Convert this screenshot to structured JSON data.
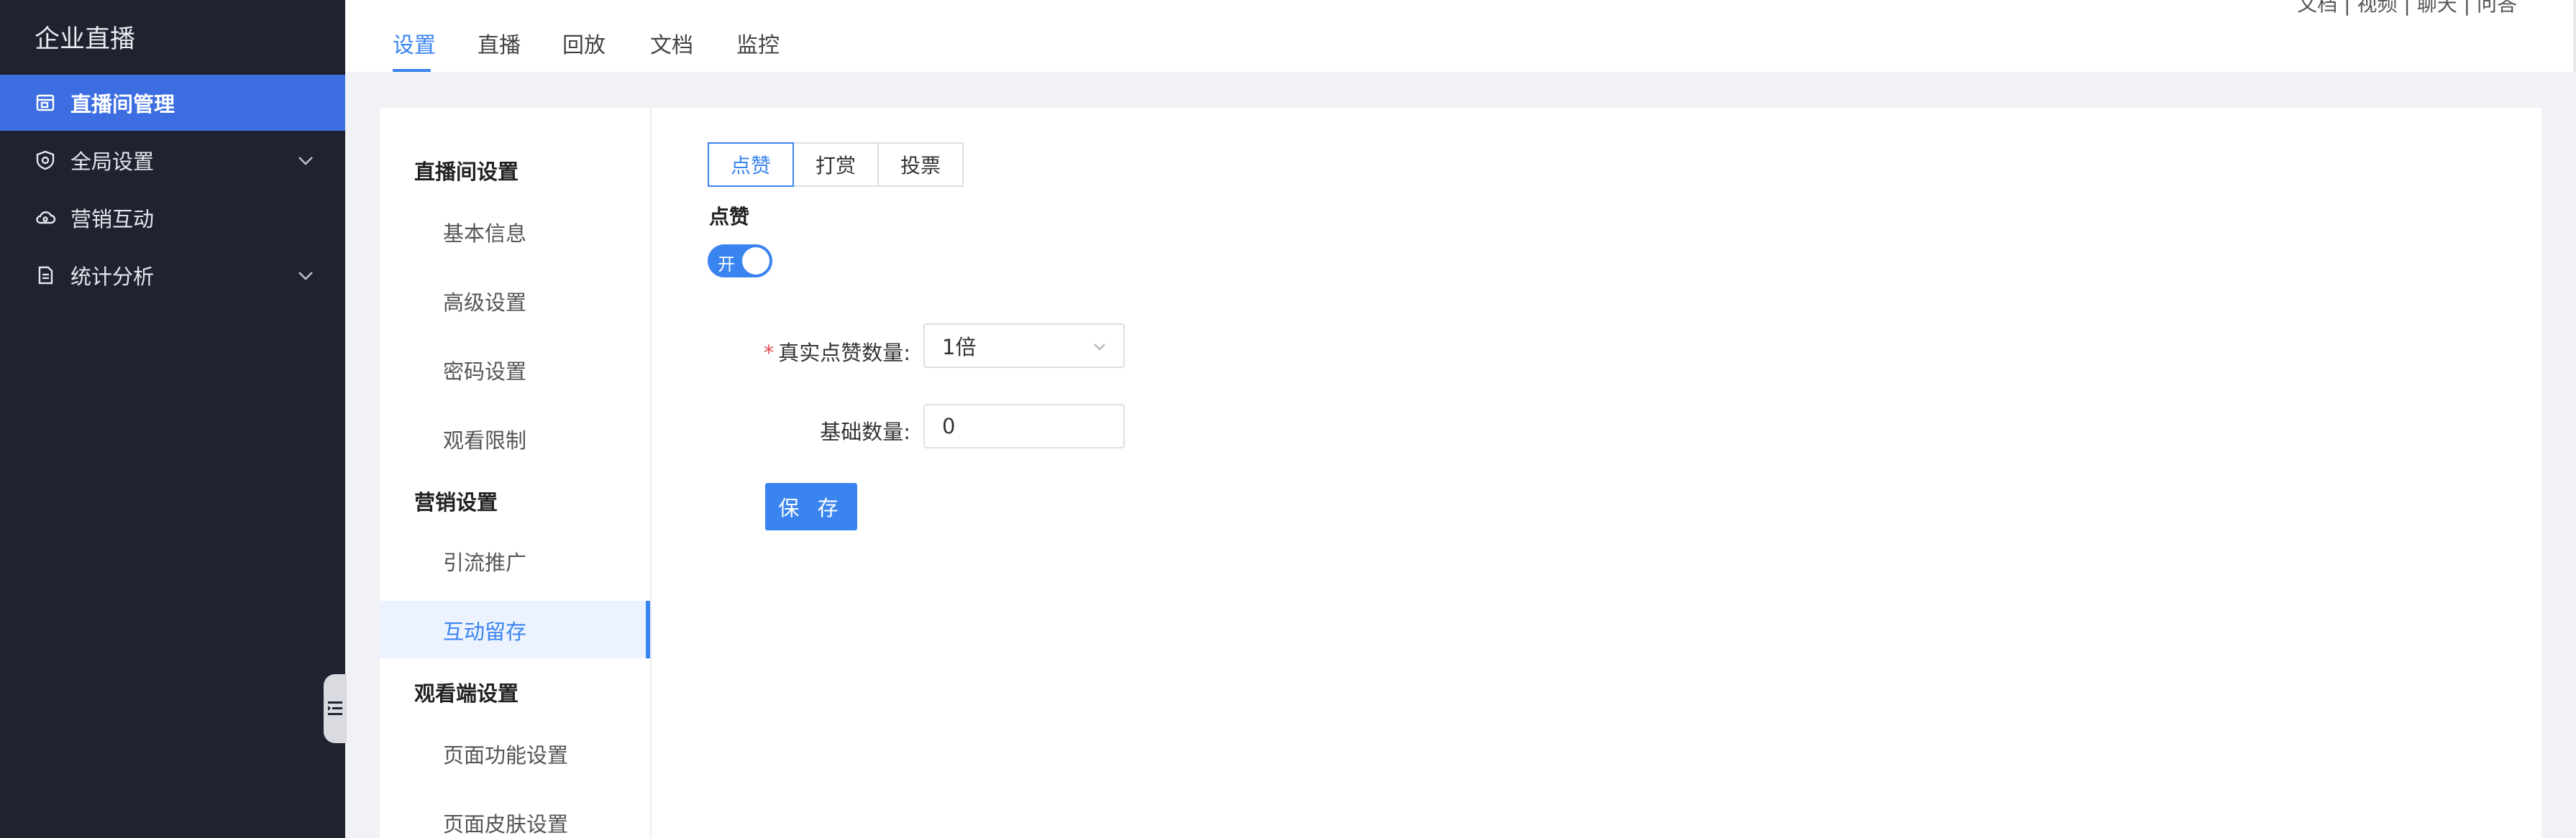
{
  "app": {
    "brand": "企业直播"
  },
  "sidebar": {
    "items": [
      {
        "label": "直播间管理",
        "icon": "live-room-icon",
        "active": true
      },
      {
        "label": "全局设置",
        "icon": "shield-icon",
        "expandable": true
      },
      {
        "label": "营销互动",
        "icon": "cloud-icon"
      },
      {
        "label": "统计分析",
        "icon": "report-icon",
        "expandable": true
      }
    ]
  },
  "header": {
    "tabs": [
      {
        "label": "设置",
        "active": true
      },
      {
        "label": "直播"
      },
      {
        "label": "回放"
      },
      {
        "label": "文档"
      },
      {
        "label": "监控"
      }
    ],
    "top_right_text": "文档 | 视频 | 聊天 | 问答"
  },
  "subnav": {
    "groups": [
      {
        "title": "直播间设置",
        "items": [
          "基本信息",
          "高级设置",
          "密码设置",
          "观看限制"
        ]
      },
      {
        "title": "营销设置",
        "items": [
          "引流推广",
          "互动留存"
        ]
      },
      {
        "title": "观看端设置",
        "items": [
          "页面功能设置",
          "页面皮肤设置"
        ]
      }
    ],
    "active_item": "互动留存"
  },
  "content": {
    "segments": [
      {
        "label": "点赞",
        "active": true
      },
      {
        "label": "打赏"
      },
      {
        "label": "投票"
      }
    ],
    "section_title": "点赞",
    "toggle": {
      "label": "开",
      "on": true
    },
    "form": {
      "real_likes_label": "真实点赞数量:",
      "real_likes_required_mark": "*",
      "real_likes_value": "1倍",
      "base_count_label": "基础数量:",
      "base_count_value": "0"
    },
    "save_label": "保 存"
  },
  "colors": {
    "sidebar_bg": "#1f2330",
    "sidebar_active": "#3c6ee2",
    "accent": "#3a84f0",
    "page_bg": "#f0f2f5",
    "required": "#e34b4b"
  }
}
